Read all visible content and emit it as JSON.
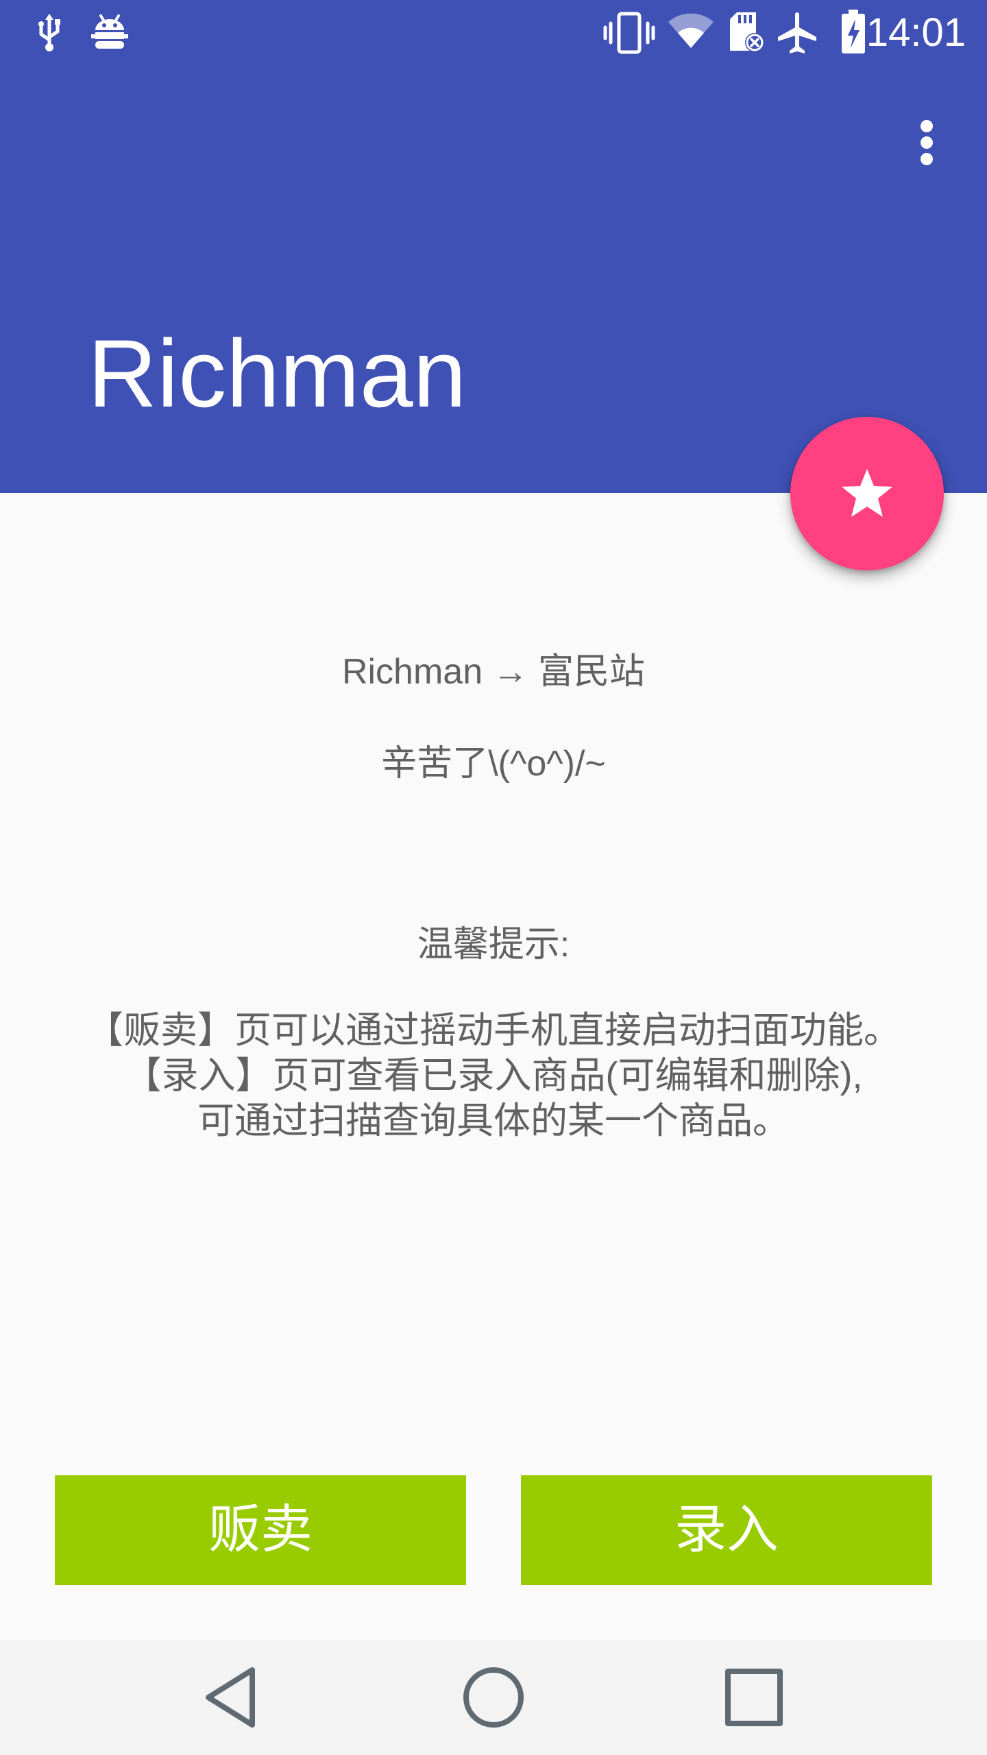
{
  "status_bar": {
    "time": "14:01",
    "left_icons": [
      "usb-icon",
      "android-debug-icon"
    ],
    "right_icons": [
      "vibrate-icon",
      "wifi-icon",
      "sd-card-error-icon",
      "airplane-mode-icon",
      "battery-charging-icon"
    ]
  },
  "app_bar": {
    "title": "Richman",
    "menu_icon": "more-vert-icon"
  },
  "fab": {
    "icon": "star-icon"
  },
  "content": {
    "subtitle": "Richman → 富民站",
    "greeting": "辛苦了\\(^o^)/~",
    "tips_title": "温馨提示:",
    "tips_lines": [
      "【贩卖】页可以通过摇动手机直接启动扫面功能。",
      "【录入】页可查看已录入商品(可编辑和删除),",
      "可通过扫描查询具体的某一个商品。"
    ]
  },
  "buttons": {
    "sell_label": "贩卖",
    "entry_label": "录入"
  },
  "nav_bar": {
    "icons": [
      "back-icon",
      "home-icon",
      "recents-icon"
    ]
  },
  "colors": {
    "primary": "#3f51b5",
    "accent": "#ff4081",
    "button": "#99cc00",
    "background": "#fafafa",
    "text": "#616161",
    "nav_bar": "#f3f3f3"
  }
}
